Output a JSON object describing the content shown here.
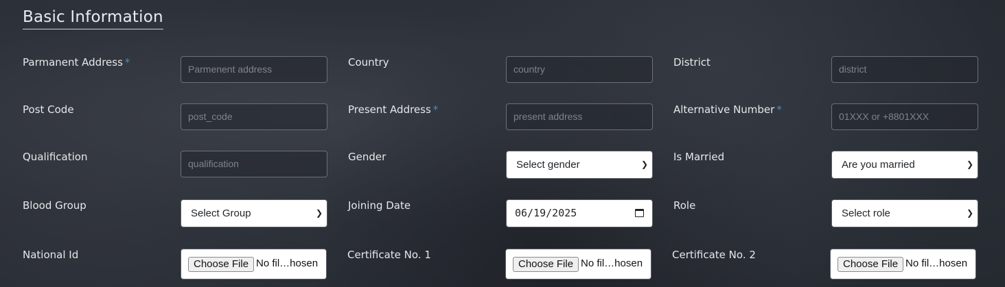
{
  "section": {
    "title": "Basic Information"
  },
  "fields": {
    "permanent_address": {
      "label": "Parmanent Address",
      "required": "*",
      "placeholder": "Parmenent address"
    },
    "country": {
      "label": "Country",
      "placeholder": "country"
    },
    "district": {
      "label": "District",
      "placeholder": "district"
    },
    "post_code": {
      "label": "Post Code",
      "placeholder": "post_code"
    },
    "present_address": {
      "label": "Present Address",
      "required": "*",
      "placeholder": "present address"
    },
    "alternative_number": {
      "label": "Alternative Number",
      "required": "*",
      "placeholder": "01XXX or +8801XXX"
    },
    "qualification": {
      "label": "Qualification",
      "placeholder": "qualification"
    },
    "gender": {
      "label": "Gender",
      "selected": "Select gender"
    },
    "is_married": {
      "label": "Is Married",
      "selected": "Are you married"
    },
    "blood_group": {
      "label": "Blood Group",
      "selected": "Select Group"
    },
    "joining_date": {
      "label": "Joining Date",
      "value": "06/19/2025"
    },
    "role": {
      "label": "Role",
      "selected": "Select role"
    },
    "national_id": {
      "label": "National Id",
      "button": "Choose File",
      "status": "No fil…hosen"
    },
    "certificate_1": {
      "label": "Certificate No. 1",
      "button": "Choose File",
      "status": "No fil…hosen"
    },
    "certificate_2": {
      "label": "Certificate No. 2",
      "button": "Choose File",
      "status": "No fil…hosen"
    }
  },
  "icons": {
    "select_chevron": "chevron-down-icon",
    "date_picker": "calendar-icon"
  }
}
